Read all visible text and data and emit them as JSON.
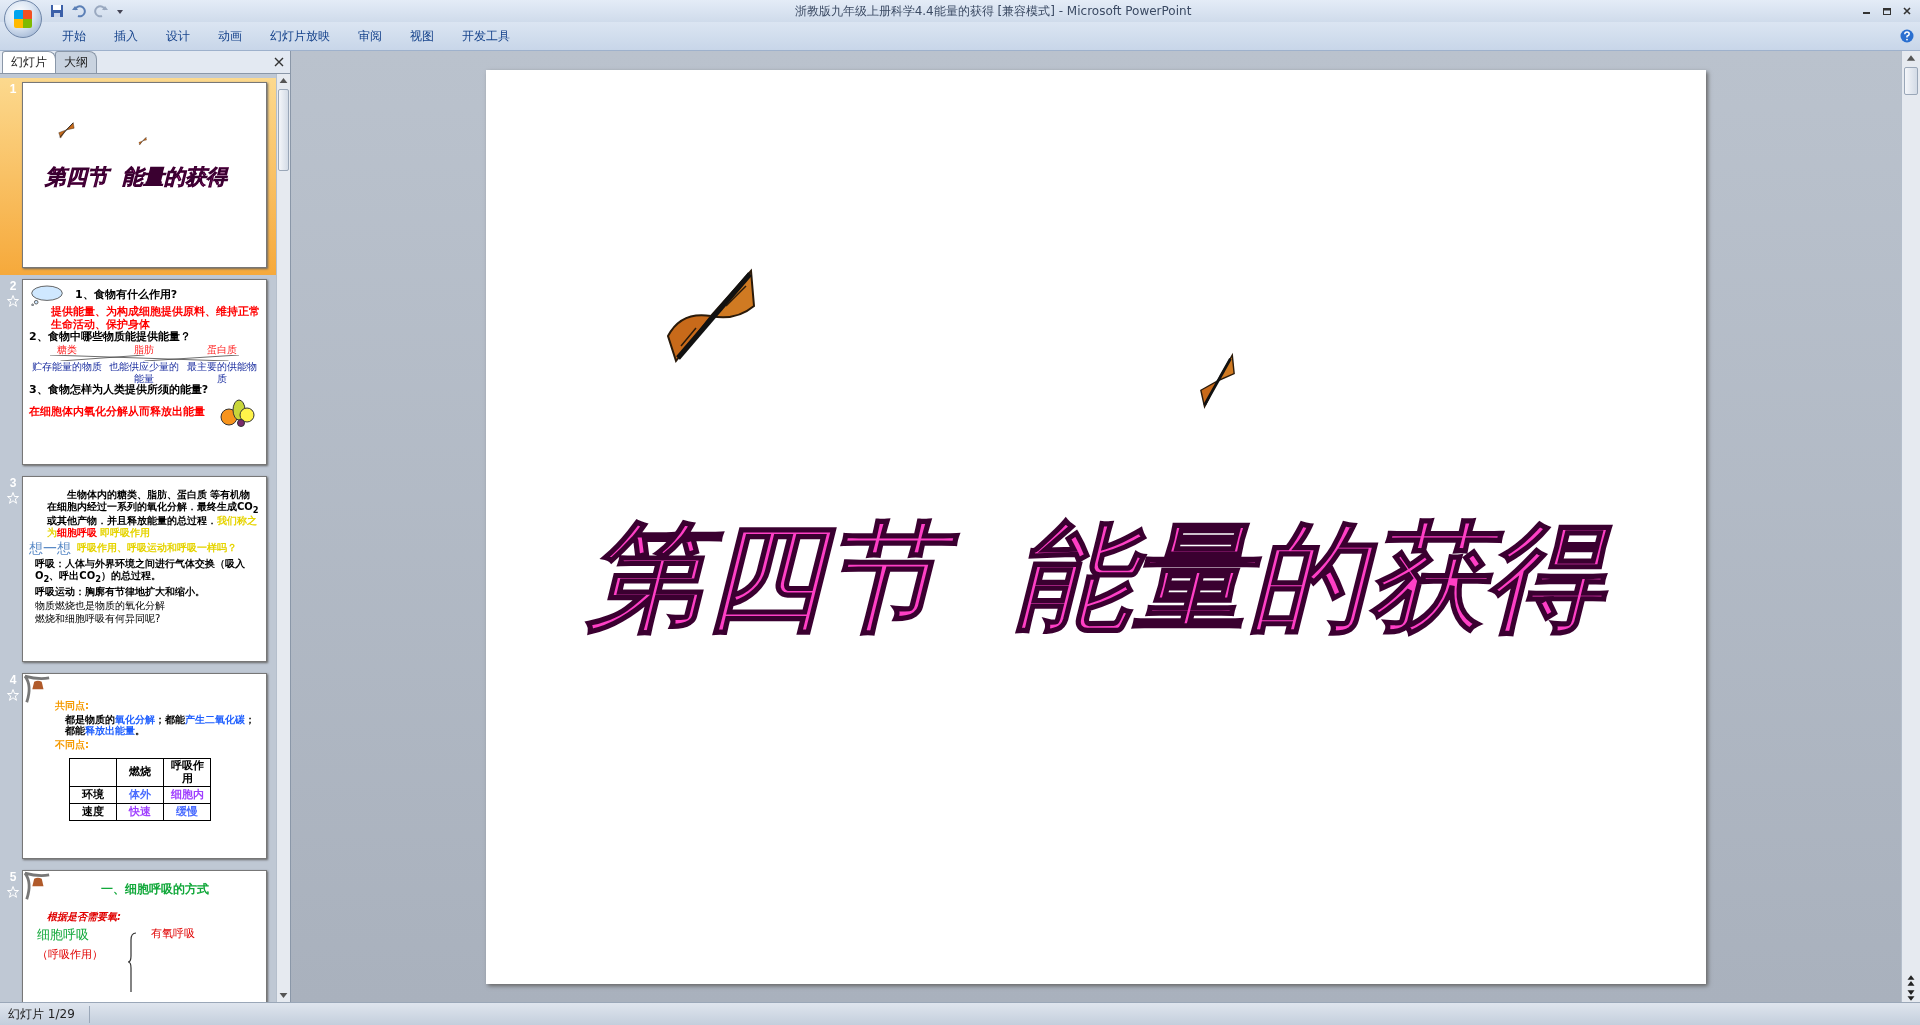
{
  "window": {
    "title": "浙教版九年级上册科学4.4能量的获得 [兼容模式] - Microsoft PowerPoint"
  },
  "ribbon_tabs": [
    "开始",
    "插入",
    "设计",
    "动画",
    "幻灯片放映",
    "审阅",
    "视图",
    "开发工具"
  ],
  "panel_tabs": [
    {
      "label": "幻灯片",
      "selected": true
    },
    {
      "label": "大纲",
      "selected": false
    }
  ],
  "thumbnails": [
    {
      "number": "1",
      "selected": true,
      "animated": false,
      "kind": "title",
      "title_parts": [
        "第四节",
        "能量的获得"
      ]
    },
    {
      "number": "2",
      "selected": false,
      "animated": true,
      "kind": "qa",
      "q1": "1、食物有什么作用?",
      "a1": "提供能量、为构成细胞提供原料、维持正常生命活动、保护身体",
      "q2": "2、食物中哪些物质能提供能量？",
      "nutrients": [
        "糖类",
        "脂肪",
        "蛋白质"
      ],
      "roles": [
        "贮存能量的物质",
        "也能供应少量的能量",
        "最主要的供能物质"
      ],
      "q3": "3、食物怎样为人类提供所须的能量?",
      "a3": "在细胞体内氧化分解从而释放出能量"
    },
    {
      "number": "3",
      "selected": false,
      "animated": true,
      "kind": "text",
      "paragraph": "生物体内的糖类、脂肪、蛋白质 等有机物在细胞内经过一系列的氧化分解．最终生成CO$_{2}$或其他产物．并且释放能量的总过程．",
      "conclusion": [
        {
          "text": "我们称之为",
          "emphasis": false
        },
        {
          "text": "细胞呼吸",
          "emphasis": true
        },
        {
          "text": " 即呼吸作用",
          "emphasis": false
        }
      ],
      "think_label": "想一想",
      "think_question": "呼吸作用、呼吸运动和呼吸一样吗？",
      "notes": [
        "呼吸：人体与外界环境之间进行气体交换（吸入O$_{2}$、呼出CO$_{2}$）的总过程。",
        "呼吸运动：胸廓有节律地扩大和缩小。"
      ],
      "questions": [
        "物质燃烧也是物质的氧化分解",
        "燃烧和细胞呼吸有何异同呢?"
      ]
    },
    {
      "number": "4",
      "selected": false,
      "animated": true,
      "kind": "compare",
      "bullet1": "共同点:",
      "segments": [
        {
          "text": "都是物质的",
          "highlight": false
        },
        {
          "text": "氧化分解",
          "highlight": true
        },
        {
          "text": "；都能",
          "highlight": false
        },
        {
          "text": "产生二氧化碳",
          "highlight": true
        },
        {
          "text": "；都能",
          "highlight": false
        },
        {
          "text": "释放出能量",
          "highlight": true
        },
        {
          "text": "。",
          "highlight": false
        }
      ],
      "bullet2": "不同点:",
      "columns": [
        "燃烧",
        "呼吸作用"
      ],
      "rows": [
        {
          "label": "环境",
          "cells": [
            {
              "text": "体外",
              "color": "#4a6cff"
            },
            {
              "text": "细胞内",
              "color": "#a040ff"
            }
          ]
        },
        {
          "label": "速度",
          "cells": [
            {
              "text": "快速",
              "color": "#a040ff"
            },
            {
              "text": "缓慢",
              "color": "#4a6cff"
            }
          ]
        }
      ]
    },
    {
      "number": "5",
      "selected": false,
      "animated": true,
      "kind": "outline",
      "heading": "一、细胞呼吸的方式",
      "basis": "根据是否需要氧:",
      "term": "细胞呼吸",
      "term_note": "（呼吸作用）",
      "branch": "有氧呼吸"
    }
  ],
  "slide": {
    "title_parts": [
      "第四节",
      "能量的获得"
    ]
  },
  "status_bar": {
    "slide_counter": "幻灯片 1/29"
  }
}
